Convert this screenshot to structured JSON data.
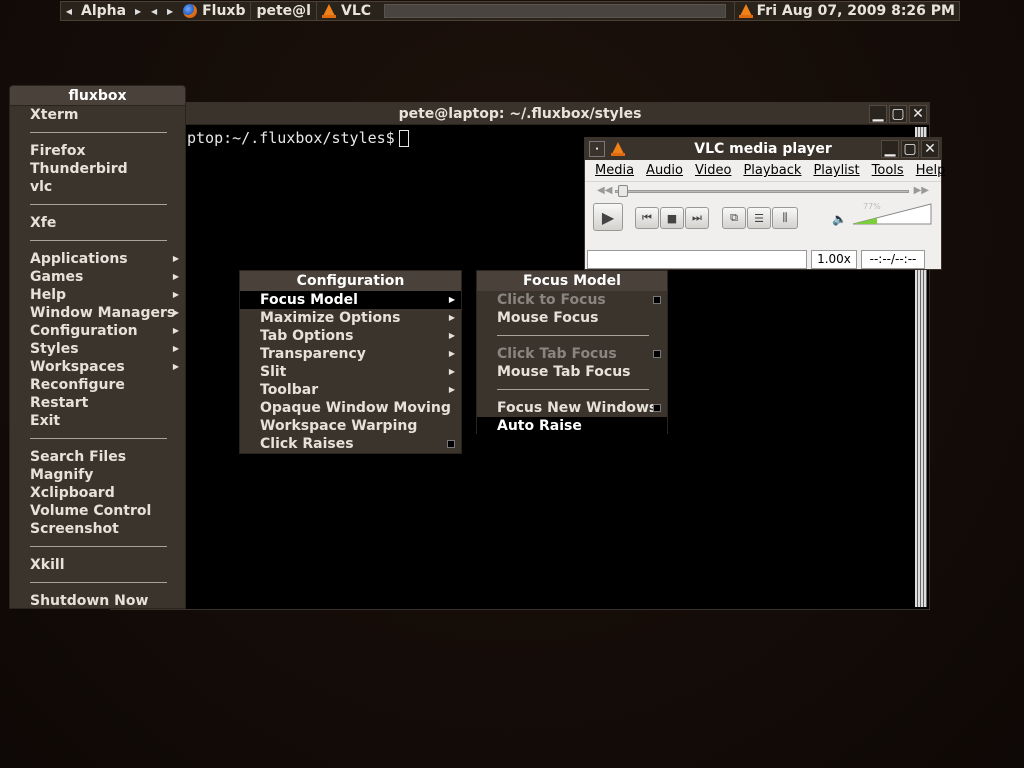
{
  "toolbar": {
    "workspace": "Alpha",
    "tasks": [
      {
        "label": "Fluxb",
        "icon": "firefox-icon"
      },
      {
        "label": "pete@l",
        "icon": null
      },
      {
        "label": "VLC",
        "icon": "vlc-icon"
      }
    ],
    "clock": "Fri Aug 07, 2009  8:26 PM"
  },
  "terminal": {
    "title": "pete@laptop: ~/.fluxbox/styles",
    "prompt": "ptop:~/.fluxbox/styles$"
  },
  "root_menu": {
    "title": "fluxbox",
    "items": [
      {
        "label": "Xterm"
      },
      {
        "sep": true
      },
      {
        "label": "Firefox"
      },
      {
        "label": "Thunderbird"
      },
      {
        "label": "vlc"
      },
      {
        "sep": true
      },
      {
        "label": "Xfe"
      },
      {
        "sep": true
      },
      {
        "label": "Applications",
        "submenu": true
      },
      {
        "label": "Games",
        "submenu": true
      },
      {
        "label": "Help",
        "submenu": true
      },
      {
        "label": "Window Managers",
        "submenu": true
      },
      {
        "label": "Configuration",
        "submenu": true
      },
      {
        "label": "Styles",
        "submenu": true
      },
      {
        "label": "Workspaces",
        "submenu": true
      },
      {
        "label": "Reconfigure"
      },
      {
        "label": "Restart"
      },
      {
        "label": "Exit"
      },
      {
        "sep": true
      },
      {
        "label": "Search Files"
      },
      {
        "label": "Magnify"
      },
      {
        "label": "Xclipboard"
      },
      {
        "label": "Volume Control"
      },
      {
        "label": "Screenshot"
      },
      {
        "sep": true
      },
      {
        "label": "Xkill"
      },
      {
        "sep": true
      },
      {
        "label": "Shutdown Now"
      }
    ]
  },
  "config_menu": {
    "title": "Configuration",
    "items": [
      {
        "label": "Focus Model",
        "submenu": true,
        "active": true
      },
      {
        "label": "Maximize Options",
        "submenu": true
      },
      {
        "label": "Tab Options",
        "submenu": true
      },
      {
        "label": "Transparency",
        "submenu": true
      },
      {
        "label": "Slit",
        "submenu": true
      },
      {
        "label": "Toolbar",
        "submenu": true
      },
      {
        "label": "Opaque Window Moving"
      },
      {
        "label": "Workspace Warping"
      },
      {
        "label": "Click Raises",
        "checked": true
      }
    ]
  },
  "focus_menu": {
    "title": "Focus Model",
    "items": [
      {
        "label": "Click to Focus",
        "disabled": true,
        "checked": true
      },
      {
        "label": "Mouse Focus"
      },
      {
        "sep": true
      },
      {
        "label": "Click Tab Focus",
        "disabled": true,
        "checked": true
      },
      {
        "label": "Mouse Tab Focus"
      },
      {
        "sep": true
      },
      {
        "label": "Focus New Windows",
        "checked": true
      },
      {
        "label": "Auto Raise",
        "active": true
      }
    ]
  },
  "vlc": {
    "title": "VLC media player",
    "menu": [
      "Media",
      "Audio",
      "Video",
      "Playback",
      "Playlist",
      "Tools",
      "Help"
    ],
    "volume_percent": 77,
    "volume_label": "77%",
    "speed": "1.00x",
    "time": "--:--/--:--"
  }
}
